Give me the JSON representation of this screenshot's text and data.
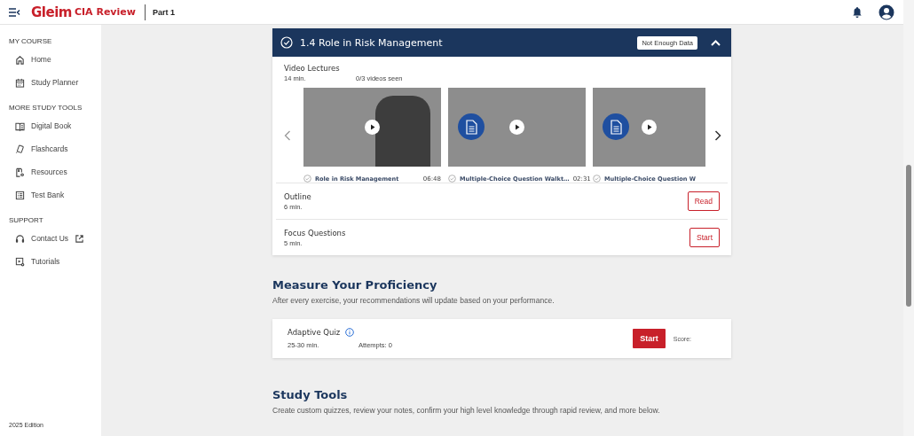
{
  "header": {
    "brand": "Gleim",
    "product": "CIA Review",
    "part": "Part 1"
  },
  "sidebar": {
    "sections": [
      {
        "title": "MY COURSE",
        "items": [
          {
            "label": "Home",
            "kind": "home"
          },
          {
            "label": "Study Planner",
            "kind": "calendar"
          }
        ]
      },
      {
        "title": "MORE STUDY TOOLS",
        "items": [
          {
            "label": "Digital Book",
            "kind": "book"
          },
          {
            "label": "Flashcards",
            "kind": "cards"
          },
          {
            "label": "Resources",
            "kind": "resources"
          },
          {
            "label": "Test Bank",
            "kind": "list"
          }
        ]
      },
      {
        "title": "SUPPORT",
        "items": [
          {
            "label": "Contact Us",
            "kind": "headset",
            "external": true
          },
          {
            "label": "Tutorials",
            "kind": "tutorial"
          }
        ]
      }
    ],
    "edition": "2025 Edition"
  },
  "lesson": {
    "title": "1.4 Role in Risk Management",
    "badge": "Not Enough Data",
    "expanded": true,
    "video_lectures": {
      "title": "Video Lectures",
      "duration": "14 min.",
      "seen": "0/3 videos seen",
      "videos": [
        {
          "kind": "lecture",
          "caption": "Role in Risk Management",
          "time": "06:48"
        },
        {
          "kind": "document",
          "caption": "Multiple-Choice Question Walkt…",
          "time": "02:31"
        },
        {
          "kind": "document",
          "caption": "Multiple-Choice Question W"
        }
      ]
    },
    "items": [
      {
        "title": "Outline",
        "duration": "6 min.",
        "action": "Read"
      },
      {
        "title": "Focus Questions",
        "duration": "5 min.",
        "action": "Start"
      }
    ]
  },
  "proficiency": {
    "title": "Measure Your Proficiency",
    "subtitle": "After every exercise, your recommendations will update based on your performance.",
    "quiz": {
      "title": "Adaptive Quiz",
      "duration": "25-30 min.",
      "attempts": "Attempts: 0",
      "action": "Start",
      "score": "Score:"
    }
  },
  "study_tools": {
    "title": "Study Tools",
    "subtitle": "Create custom quizzes, review your notes, confirm your high level knowledge through rapid review, and more below."
  }
}
